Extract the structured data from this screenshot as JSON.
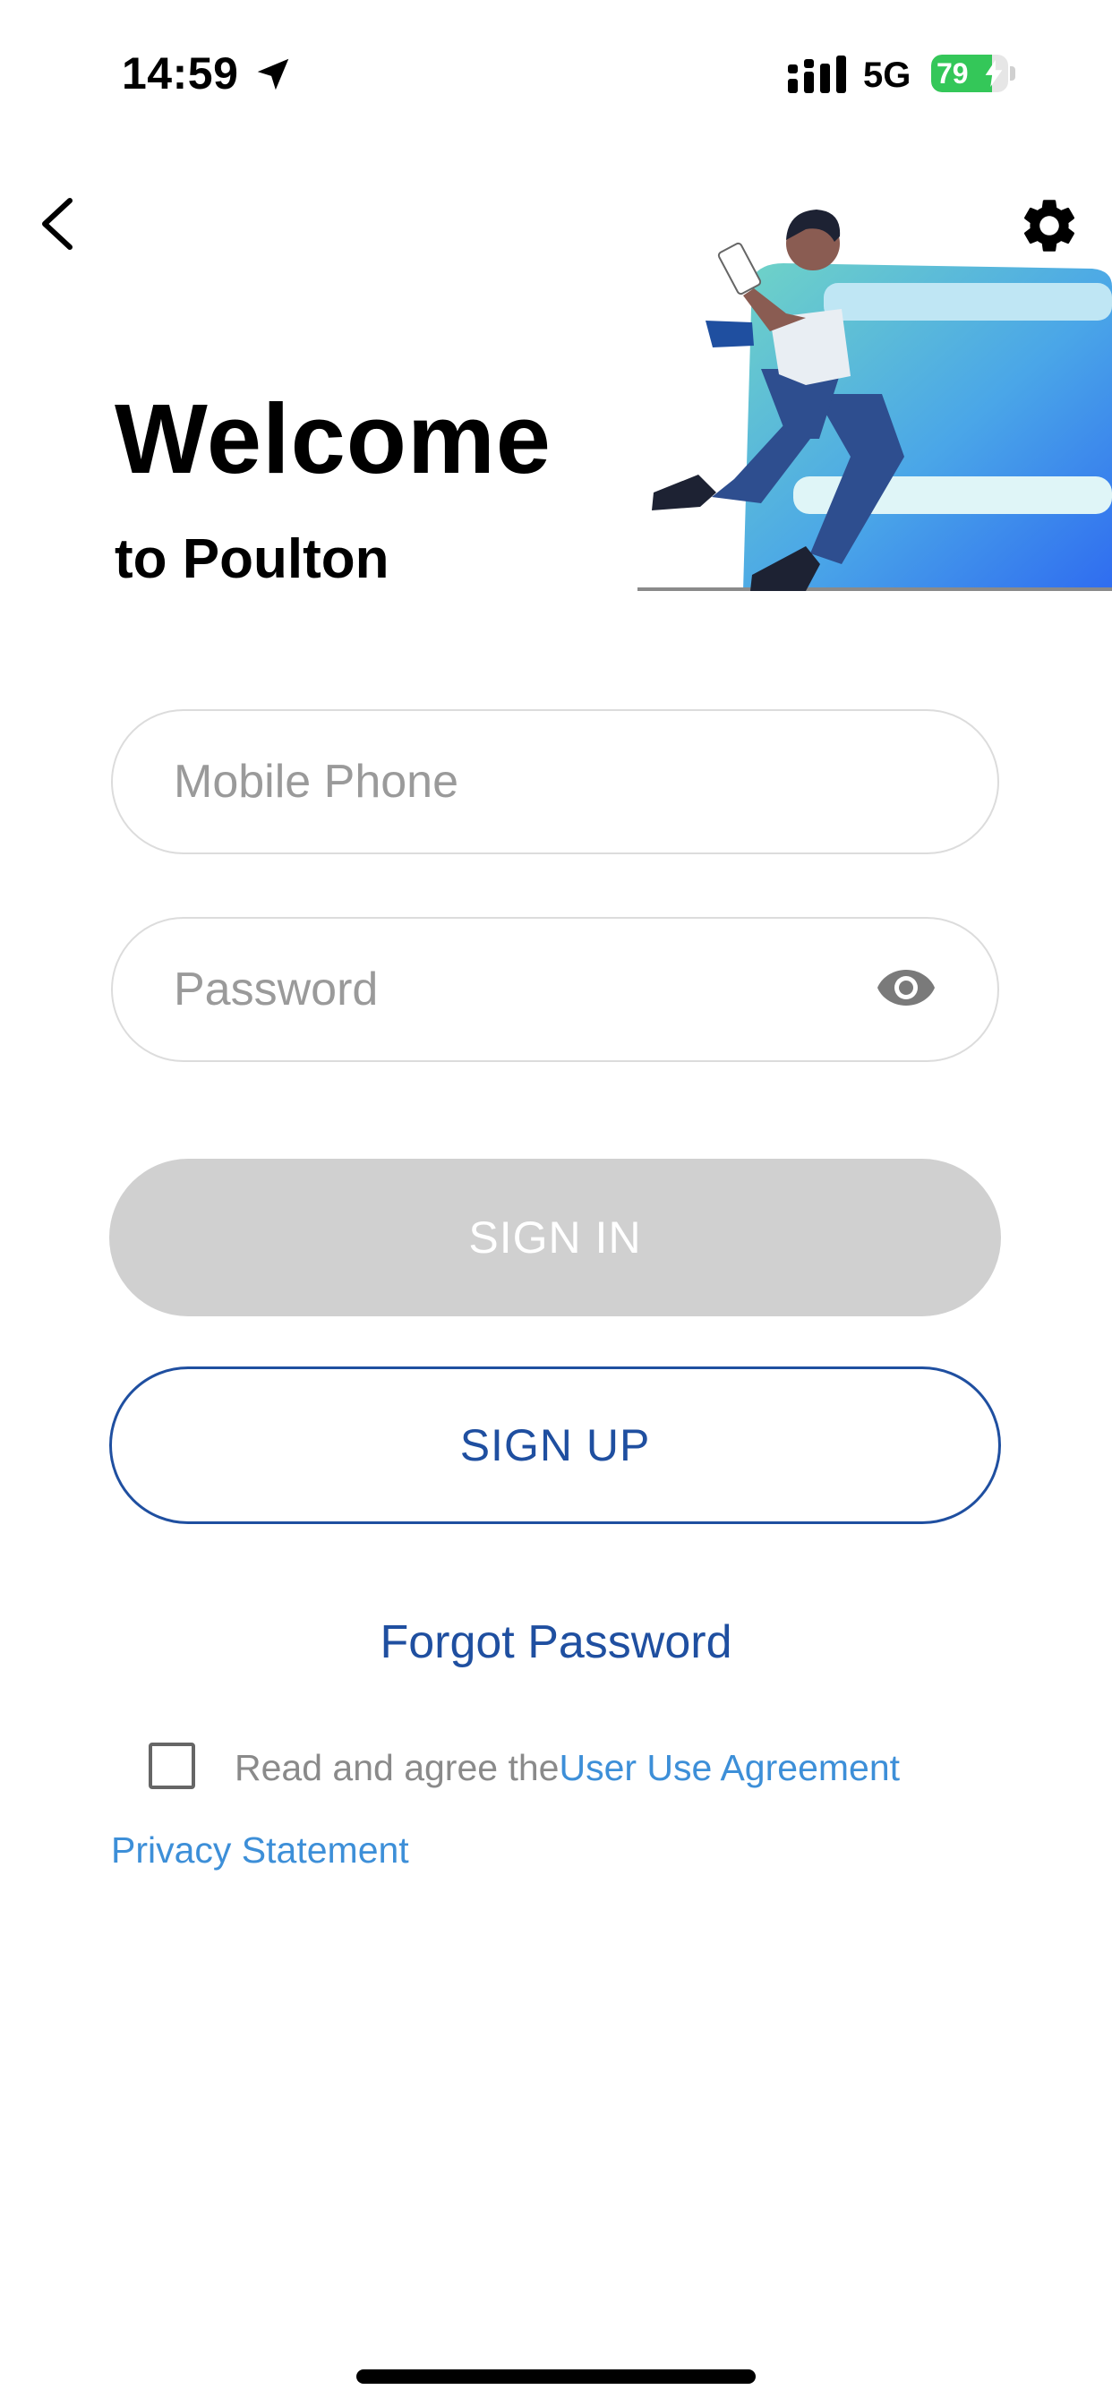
{
  "status_bar": {
    "time": "14:59",
    "network": "5G",
    "battery_percent": 79,
    "battery_label": "79",
    "battery_color": "#34c759"
  },
  "nav": {
    "back_icon": "chevron-left-icon",
    "settings_icon": "gear-icon"
  },
  "welcome": {
    "title": "Welcome",
    "subtitle": "to Poulton"
  },
  "form": {
    "phone_placeholder": "Mobile Phone",
    "password_placeholder": "Password",
    "password_toggle_icon": "eye-icon",
    "sign_in_label": "SIGN IN",
    "sign_up_label": "SIGN UP",
    "forgot_password_label": "Forgot Password"
  },
  "agreement": {
    "checked": false,
    "prefix_text": "Read and agree the",
    "user_agreement_link": "User Use Agreement",
    "privacy_link": "Privacy Statement"
  },
  "colors": {
    "accent": "#1f4fa0",
    "link": "#3d8fd8",
    "disabled_button": "#d0d0d0",
    "input_border": "#dcdcdc"
  }
}
